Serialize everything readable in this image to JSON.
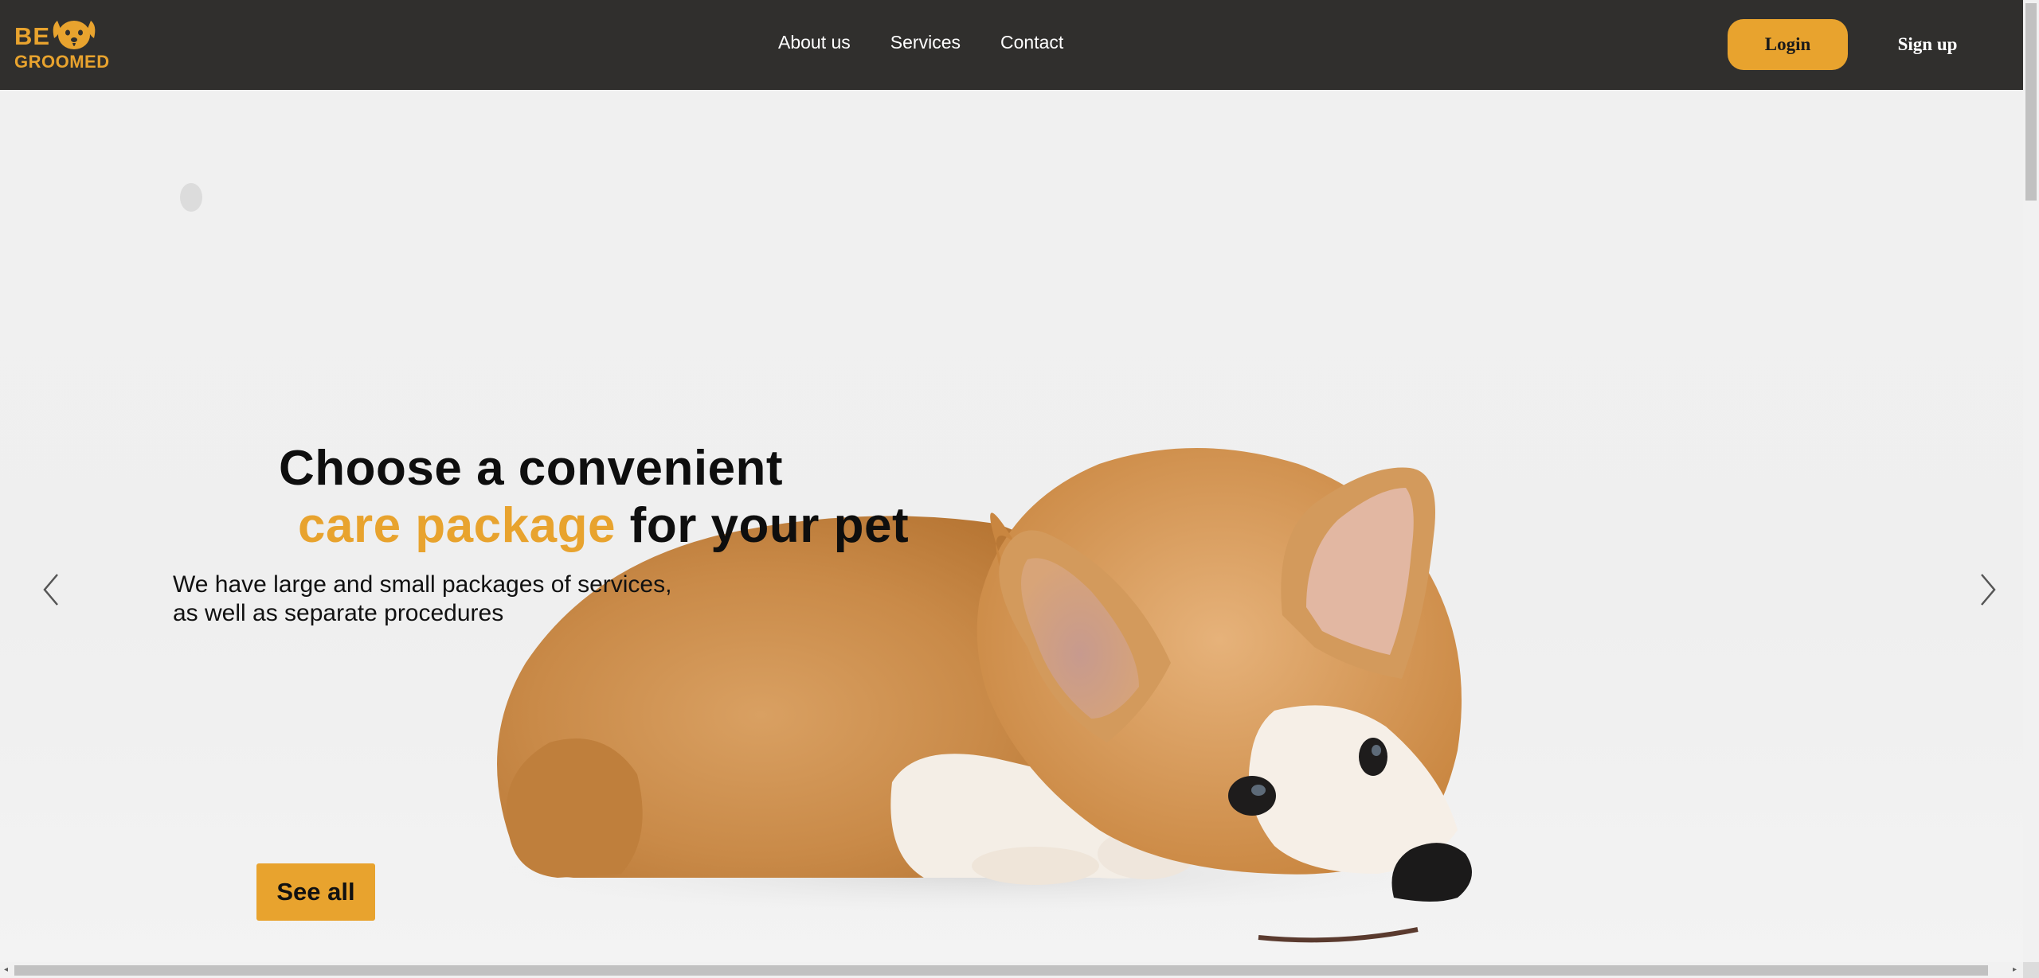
{
  "logo": {
    "line1": "BE",
    "line2": "GROOMED",
    "icon": "dog-face-icon"
  },
  "nav": {
    "items": [
      "About us",
      "Services",
      "Contact"
    ]
  },
  "auth": {
    "login_label": "Login",
    "signup_label": "Sign up"
  },
  "hero": {
    "headline_line1": "Choose a convenient",
    "headline_accent": "care package",
    "headline_rest": " for your pet",
    "subtext_line1": "We have large and small packages of services,",
    "subtext_line2": "as well as separate procedures",
    "cta_label": "See all",
    "prev_icon": "chevron-left-icon",
    "next_icon": "chevron-right-icon"
  },
  "colors": {
    "accent": "#e8a32e",
    "header_bg": "#302f2d",
    "hero_bg": "#f0f0f0"
  }
}
